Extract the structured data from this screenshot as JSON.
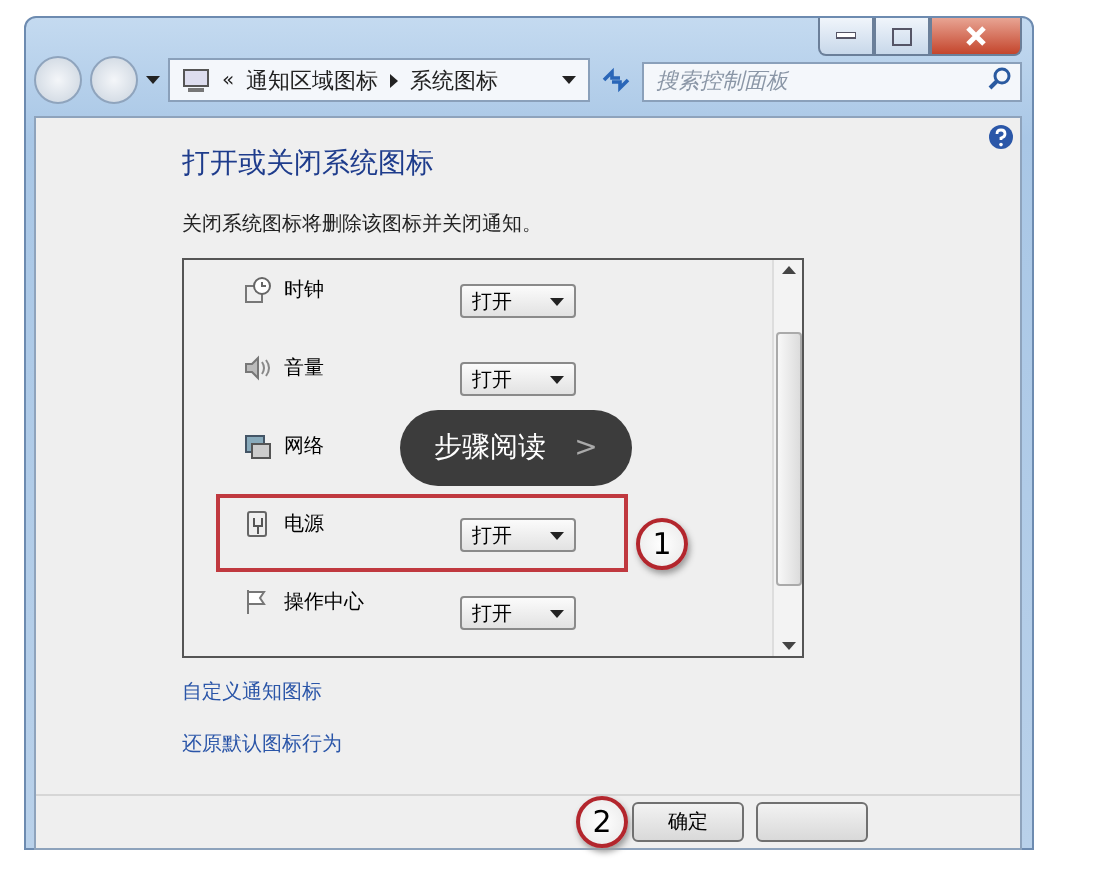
{
  "address_bar": {
    "overflow": "«",
    "crumbs": [
      "通知区域图标",
      "系统图标"
    ]
  },
  "search": {
    "placeholder": "搜索控制面板"
  },
  "heading": "打开或关闭系统图标",
  "description": "关闭系统图标将删除该图标并关闭通知。",
  "icons": [
    {
      "kind": "clock",
      "name": "时钟",
      "value": "打开",
      "highlighted": false
    },
    {
      "kind": "volume",
      "name": "音量",
      "value": "打开",
      "highlighted": false
    },
    {
      "kind": "network",
      "name": "网络",
      "highlighted": false
    },
    {
      "kind": "power",
      "name": "电源",
      "value": "打开",
      "highlighted": true,
      "marker": "1"
    },
    {
      "kind": "flag",
      "name": "操作中心",
      "value": "打开",
      "highlighted": false
    }
  ],
  "overlay": {
    "label": "步骤阅读",
    "arrow": ">"
  },
  "links": [
    "自定义通知图标",
    "还原默认图标行为"
  ],
  "buttons": [
    {
      "kind": "labelled",
      "label": "确定",
      "marker": "2"
    },
    {
      "kind": "blank"
    }
  ]
}
